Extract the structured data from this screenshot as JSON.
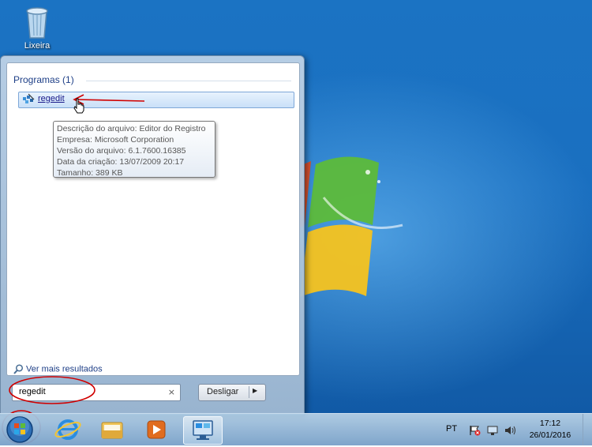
{
  "desktop": {
    "recycle_bin_label": "Lixeira"
  },
  "start_menu": {
    "group_header": "Programas (1)",
    "result_item_label": "regedit",
    "tooltip": {
      "line1": "Descrição do arquivo: Editor do Registro",
      "line2": "Empresa: Microsoft Corporation",
      "line3": "Versão do arquivo: 6.1.7600.16385",
      "line4": "Data da criação: 13/07/2009 20:17",
      "line5": "Tamanho: 389 KB"
    },
    "more_results_label": "Ver mais resultados",
    "search_value": "regedit",
    "search_clear": "×",
    "shutdown_label": "Desligar",
    "shutdown_arrow": "▶"
  },
  "taskbar": {
    "language": "PT",
    "clock_time": "17:12",
    "clock_date": "26/01/2016"
  },
  "colors": {
    "desktop_blue": "#1b73c3",
    "annotation_red": "#d00000",
    "link_blue": "#1e3f87"
  }
}
